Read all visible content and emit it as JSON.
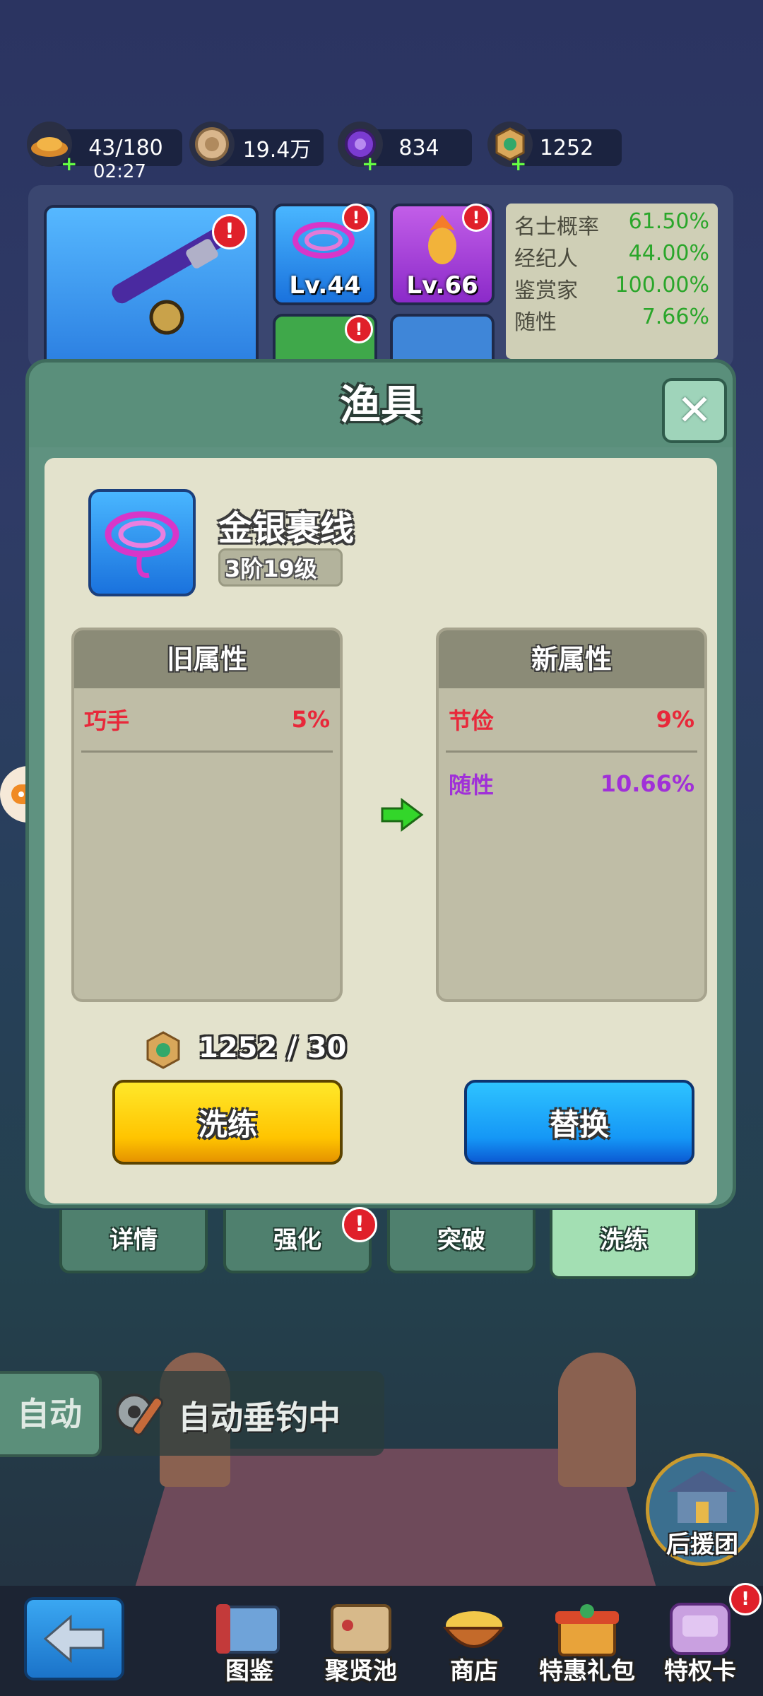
{
  "resources": [
    {
      "icon": "gold-ingot-icon",
      "value": "43/180",
      "timer": "02:27"
    },
    {
      "icon": "coin-icon",
      "value": "19.4万"
    },
    {
      "icon": "purple-gem-icon",
      "value": "834"
    },
    {
      "icon": "jade-token-icon",
      "value": "1252"
    }
  ],
  "equipment_slots": [
    {
      "icon": "fishing-rod-icon"
    },
    {
      "icon": "line-spool-icon",
      "level": "Lv.44"
    },
    {
      "icon": "float-icon",
      "level": "Lv.66"
    }
  ],
  "stats": [
    {
      "name": "名士概率",
      "value": "61.50%"
    },
    {
      "name": "经纪人",
      "value": "44.00%"
    },
    {
      "name": "鉴赏家",
      "value": "100.00%"
    },
    {
      "name": "随性",
      "value": "7.66%"
    }
  ],
  "modal": {
    "title": "渔具",
    "item_name": "金银裹线",
    "item_tier": "3阶19级",
    "old_attr_title": "旧属性",
    "new_attr_title": "新属性",
    "old_attrs": [
      {
        "name": "巧手",
        "value": "5%",
        "color": "#e8283a"
      }
    ],
    "new_attrs": [
      {
        "name": "节俭",
        "value": "9%",
        "color": "#e8283a"
      },
      {
        "name": "随性",
        "value": "10.66%",
        "color": "#a030d8"
      }
    ],
    "cost": "1252 / 30",
    "refine_button": "洗练",
    "replace_button": "替换"
  },
  "tabs": [
    {
      "label": "详情"
    },
    {
      "label": "强化"
    },
    {
      "label": "突破"
    },
    {
      "label": "洗练"
    }
  ],
  "auto": {
    "button": "自动",
    "status": "自动垂钓中"
  },
  "support_label": "后援团",
  "nav": [
    {
      "label": "图鉴"
    },
    {
      "label": "聚贤池"
    },
    {
      "label": "商店"
    },
    {
      "label": "特惠礼包"
    },
    {
      "label": "特权卡"
    }
  ],
  "colors": {
    "stat_value": "#2aa62a",
    "accent_yellow": "#ffc400",
    "accent_blue": "#1597f6",
    "panel_green": "#5f9280"
  }
}
